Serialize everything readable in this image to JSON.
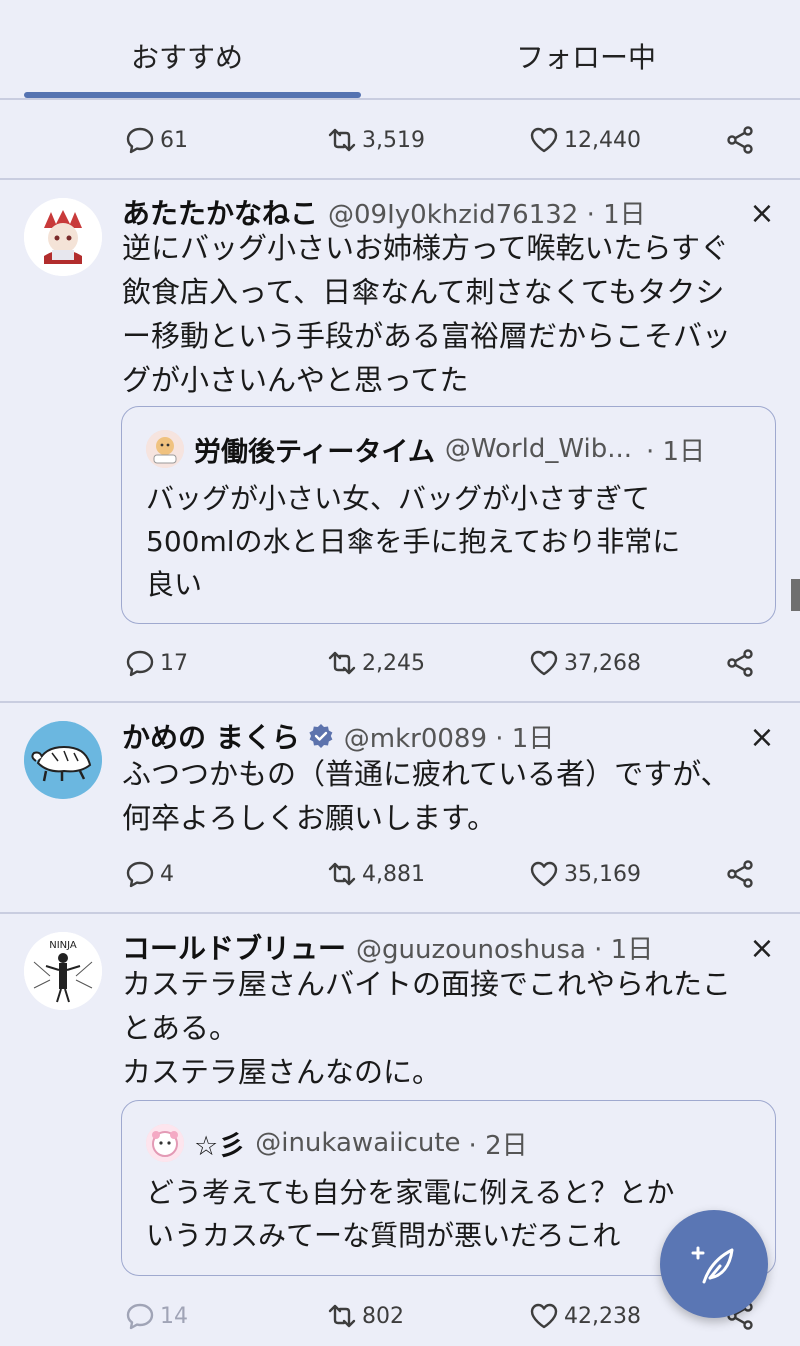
{
  "tabs": [
    {
      "label": "おすすめ",
      "active": true
    },
    {
      "label": "フォロー中",
      "active": false
    }
  ],
  "colors": {
    "accent": "#5573b1",
    "background": "#eceef8",
    "divider": "#c9cde0"
  },
  "top_actions": {
    "replies": "61",
    "retweets": "3,519",
    "likes": "12,440"
  },
  "posts": [
    {
      "name": "あたたかなねこ",
      "handle": "@09Iy0khzid76132 · 1日",
      "body": [
        "逆にバッグ小さいお姉様方って喉乾いたらすぐ",
        "飲食店入って、日傘なんて刺さなくてもタクシ",
        "ー移動という手段がある富裕層だからこそバッ",
        "グが小さいんやと思ってた"
      ],
      "quote": {
        "name": "労働後ティータイム",
        "handle": "@World_Wib...",
        "time": "· 1日",
        "body": [
          "バッグが小さい女、バッグが小さすぎて",
          "500mlの水と日傘を手に抱えており非常に",
          "良い"
        ]
      },
      "replies": "17",
      "retweets": "2,245",
      "likes": "37,268"
    },
    {
      "name": "かめの まくら",
      "handle": "@mkr0089 · 1日",
      "verified": true,
      "body": [
        "ふつつかもの（普通に疲れている者）ですが、",
        "何卒よろしくお願いします。"
      ],
      "replies": "4",
      "retweets": "4,881",
      "likes": "35,169"
    },
    {
      "name": "コールドブリュー",
      "handle": "@guuzounoshusa · 1日",
      "avatar_text": "NINJA",
      "body": [
        "カステラ屋さんバイトの面接でこれやられたこ",
        "とある。",
        "カステラ屋さんなのに。"
      ],
      "quote": {
        "name": "☆彡",
        "handle": "@inukawaiicute",
        "time": "· 2日",
        "body": [
          "どう考えても自分を家電に例えると？とか",
          "いうカスみてーな質問が悪いだろこれ"
        ]
      },
      "replies": "14",
      "retweets": "802",
      "likes": "42,238"
    }
  ],
  "icons": {
    "close": "×",
    "compose": "compose-icon",
    "share": "share-icon"
  }
}
